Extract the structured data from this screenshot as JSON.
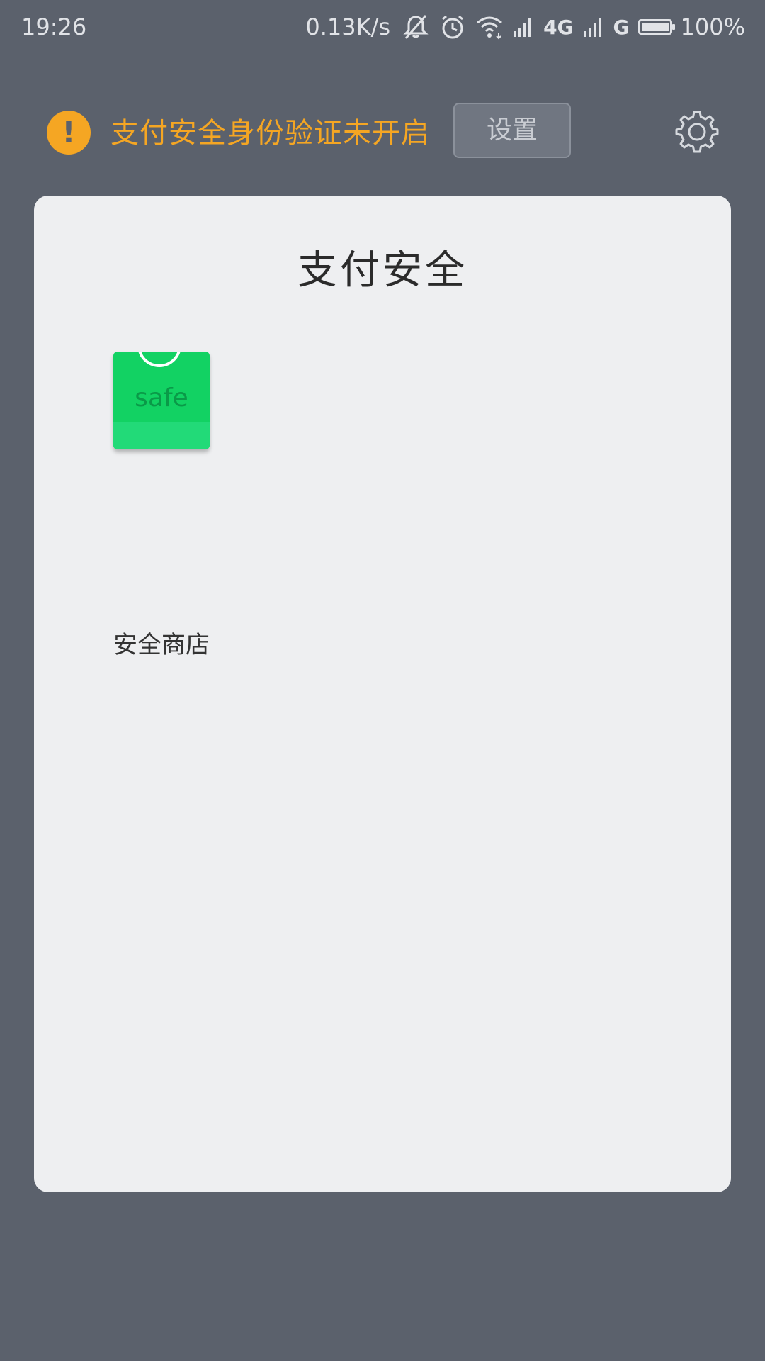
{
  "status_bar": {
    "time": "19:26",
    "net_speed": "0.13K/s",
    "net_type_1": "4G",
    "net_type_2": "G",
    "battery_percent": "100%",
    "battery_level": 1.0,
    "icons": [
      "mute-icon",
      "alarm-icon",
      "wifi-icon",
      "signal-icon",
      "signal-icon",
      "battery-icon"
    ]
  },
  "warning": {
    "icon_glyph": "!",
    "message": "支付安全身份验证未开启",
    "settings_label": "设置",
    "color": "#f5a623"
  },
  "card": {
    "title": "支付安全",
    "apps": [
      {
        "icon": "shopping-bag-icon",
        "icon_text": "safe",
        "label": "安全商店",
        "icon_color": "#12d263"
      }
    ]
  },
  "colors": {
    "background": "#5b616c",
    "card_background": "#eeeff1"
  }
}
